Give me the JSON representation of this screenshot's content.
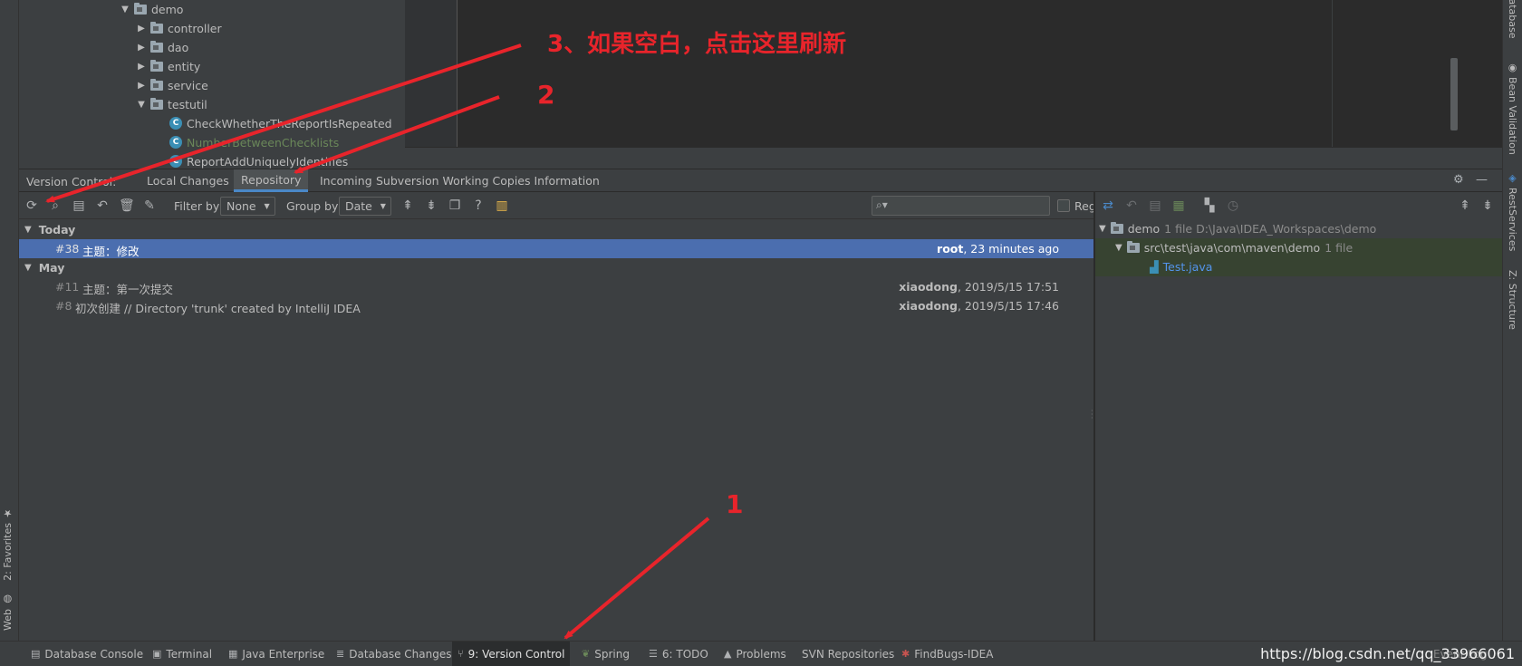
{
  "left_stripe": {
    "favorites": "2: Favorites",
    "web": "Web"
  },
  "right_stripe": {
    "database": "Database",
    "bean_validation": "Bean Validation",
    "rest_services": "RestServices",
    "structure": "Z: Structure"
  },
  "project_tree": {
    "root": "demo",
    "folders": [
      "controller",
      "dao",
      "entity",
      "service",
      "testutil"
    ],
    "classes": [
      "CheckWhetherTheReportIsRepeated",
      "NumberBetweenChecklists",
      "ReportAddUniquelyIdentifies"
    ],
    "class_icon_letter": "C",
    "highlight_color": "#6a8759"
  },
  "vc_header": {
    "title": "Version Control:",
    "tabs": [
      "Local Changes",
      "Repository",
      "Incoming",
      "Subversion Working Copies Information"
    ],
    "active_tab": "Repository"
  },
  "toolbar": {
    "filter_label": "Filter by",
    "filter_value": "None",
    "group_label": "Group by",
    "group_value": "Date",
    "help": "?",
    "regex_label": "Regex"
  },
  "log": {
    "groups": [
      {
        "label": "Today",
        "commits": [
          {
            "num": "#38",
            "msg": "主题：修改",
            "author": "root",
            "time": ", 23 minutes ago"
          }
        ]
      },
      {
        "label": "May",
        "commits": [
          {
            "num": "#11",
            "msg": "主题：第一次提交",
            "author": "xiaodong",
            "time": ", 2019/5/15 17:51"
          },
          {
            "num": "#8",
            "msg": "初次创建 // Directory 'trunk' created by IntelliJ IDEA",
            "author": "xiaodong",
            "time": ", 2019/5/15 17:46"
          }
        ]
      }
    ]
  },
  "changes": {
    "root_name": "demo",
    "root_meta": "1 file  D:\\Java\\IDEA_Workspaces\\demo",
    "dir_name": "src\\test\\java\\com\\maven\\demo",
    "dir_meta": "1 file",
    "file_name": "Test.java",
    "file_color": "#5394ec"
  },
  "bottom_bar": {
    "items": [
      "Database Console",
      "Terminal",
      "Java Enterprise",
      "Database Changes",
      "9: Version Control",
      "Spring",
      "6: TODO",
      "Problems",
      "SVN Repositories",
      "FindBugs-IDEA"
    ],
    "active": "9: Version Control",
    "event_log": "Event Log",
    "watermark": "https://blog.csdn.net/qq_33966061"
  },
  "annotations": {
    "step1": "1",
    "step2": "2",
    "step3": "3、如果空白，点击这里刷新",
    "color": "#e8242b"
  }
}
